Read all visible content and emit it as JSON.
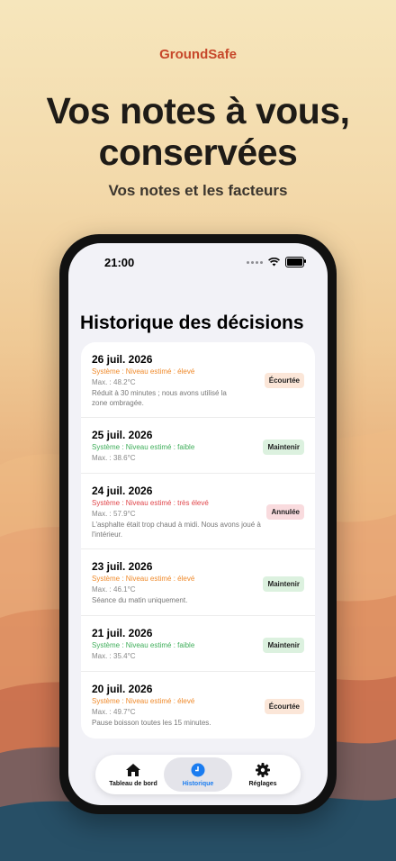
{
  "brand": "GroundSafe",
  "headline_line1": "Vos notes à vous,",
  "headline_line2": "conservées",
  "subline": "Vos notes et les facteurs",
  "status": {
    "time": "21:00"
  },
  "screen_title": "Historique des décisions",
  "entries": [
    {
      "date": "26 juil. 2026",
      "system": "Système : Niveau estimé : élevé",
      "system_color": "#ef8a2b",
      "max": "Max. : 48.2°C",
      "note": "Réduit à 30 minutes ; nous avons utilisé la zone ombragée.",
      "badge": "Écourtée",
      "badge_bg": "#fbe6d8"
    },
    {
      "date": "25 juil. 2026",
      "system": "Système : Niveau estimé : faible",
      "system_color": "#3fae5a",
      "max": "Max. : 38.6°C",
      "note": "",
      "badge": "Maintenir",
      "badge_bg": "#dcf1df"
    },
    {
      "date": "24 juil. 2026",
      "system": "Système : Niveau estimé : très élevé",
      "system_color": "#e0454a",
      "max": "Max. : 57.9°C",
      "note": "L'asphalte était trop chaud à midi. Nous avons joué à l'intérieur.",
      "badge": "Annulée",
      "badge_bg": "#f9dbde"
    },
    {
      "date": "23 juil. 2026",
      "system": "Système : Niveau estimé : élevé",
      "system_color": "#ef8a2b",
      "max": "Max. : 46.1°C",
      "note": "Séance du matin uniquement.",
      "badge": "Maintenir",
      "badge_bg": "#dcf1df"
    },
    {
      "date": "21 juil. 2026",
      "system": "Système : Niveau estimé : faible",
      "system_color": "#3fae5a",
      "max": "Max. : 35.4°C",
      "note": "",
      "badge": "Maintenir",
      "badge_bg": "#dcf1df"
    },
    {
      "date": "20 juil. 2026",
      "system": "Système : Niveau estimé : élevé",
      "system_color": "#ef8a2b",
      "max": "Max. : 49.7°C",
      "note": "Pause boisson toutes les 15 minutes.",
      "badge": "Écourtée",
      "badge_bg": "#fbe6d8"
    }
  ],
  "tabs": [
    {
      "label": "Tableau de bord",
      "icon": "house-icon"
    },
    {
      "label": "Historique",
      "icon": "clock-icon",
      "active": true
    },
    {
      "label": "Réglages",
      "icon": "gear-icon"
    }
  ],
  "colors": {
    "brand": "#c7482b",
    "accent": "#1a7cf0"
  }
}
